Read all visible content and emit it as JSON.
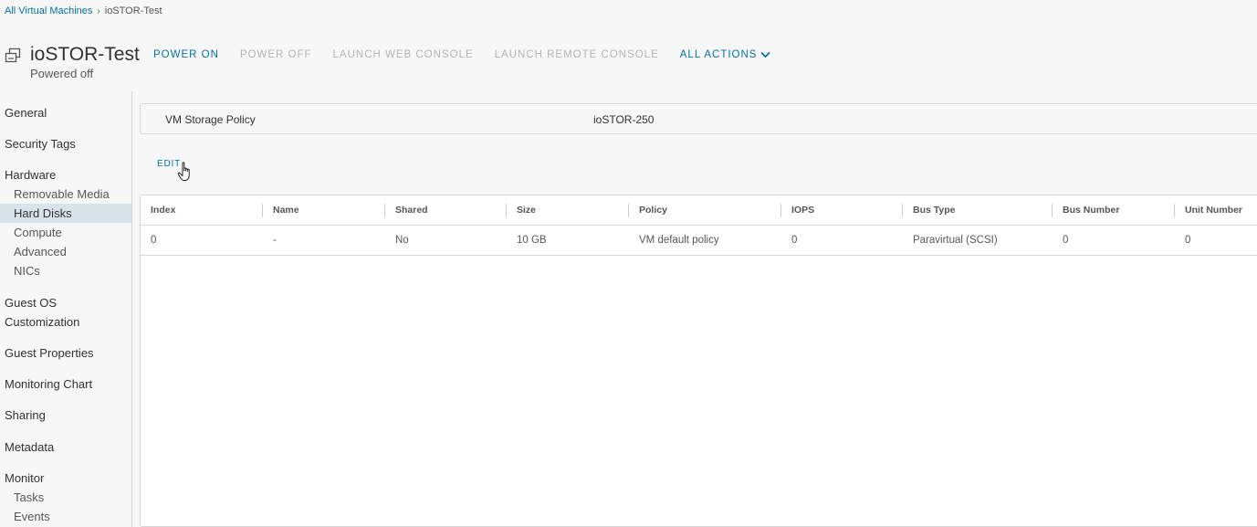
{
  "breadcrumb": {
    "root": "All Virtual Machines",
    "current": "ioSTOR-Test"
  },
  "vm": {
    "name": "ioSTOR-Test",
    "status": "Powered off",
    "icon": "vm-icon"
  },
  "actions": {
    "power_on": "POWER ON",
    "power_off": "POWER OFF",
    "launch_web_console": "LAUNCH WEB CONSOLE",
    "launch_remote_console": "LAUNCH REMOTE CONSOLE",
    "all_actions": "ALL ACTIONS"
  },
  "sidebar": {
    "general": "General",
    "security_tags": "Security Tags",
    "hardware": "Hardware",
    "removable_media": "Removable Media",
    "hard_disks": "Hard Disks",
    "compute": "Compute",
    "advanced": "Advanced",
    "nics": "NICs",
    "guest_os": "Guest OS",
    "customization": "Customization",
    "guest_properties": "Guest Properties",
    "monitoring_chart": "Monitoring Chart",
    "sharing": "Sharing",
    "metadata": "Metadata",
    "monitor": "Monitor",
    "tasks": "Tasks",
    "events": "Events"
  },
  "policy": {
    "label": "VM Storage Policy",
    "value": "ioSTOR-250"
  },
  "edit_label": "EDIT",
  "table": {
    "headers": [
      "Index",
      "Name",
      "Shared",
      "Size",
      "Policy",
      "IOPS",
      "Bus Type",
      "Bus Number",
      "Unit Number"
    ],
    "rows": [
      [
        "0",
        "-",
        "No",
        "10 GB",
        "VM default policy",
        "0",
        "Paravirtual (SCSI)",
        "0",
        "0"
      ]
    ]
  },
  "colors": {
    "link": "#0072a3",
    "disabled_action": "#b4b4b4",
    "active_nav": "#d9e4ea"
  }
}
